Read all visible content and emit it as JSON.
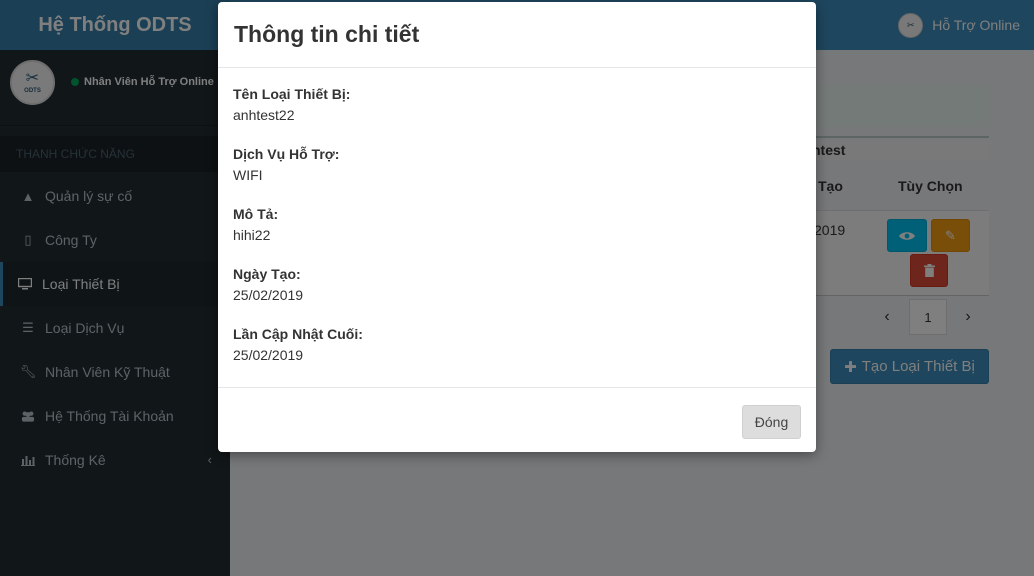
{
  "app": {
    "logo": "Hệ Thống ODTS",
    "header_user": "Hỗ Trợ Online",
    "avatar_text": "ODTS"
  },
  "sidebar": {
    "user_status": "Nhân Viên Hỗ Trợ Online",
    "section_header": "THANH CHỨC NĂNG",
    "items": [
      {
        "label": "Quản lý sự cố",
        "icon": "warning-icon"
      },
      {
        "label": "Công Ty",
        "icon": "building-icon"
      },
      {
        "label": "Loại Thiết Bị",
        "icon": "desktop-icon",
        "active": true
      },
      {
        "label": "Loại Dịch Vụ",
        "icon": "list-icon"
      },
      {
        "label": "Nhân Viên Kỹ Thuật",
        "icon": "wrench-icon"
      },
      {
        "label": "Hệ Thống Tài Khoản",
        "icon": "users-icon"
      },
      {
        "label": "Thống Kê",
        "icon": "bar-chart-icon",
        "has_submenu": true
      }
    ]
  },
  "background_content": {
    "strip_text": "ntest",
    "col_created": "Tạo",
    "col_options": "Tùy Chọn",
    "row_date": "2019",
    "current_page": "1",
    "create_button": "Tạo Loại Thiết Bị"
  },
  "modal": {
    "title": "Thông tin chi tiết",
    "fields": [
      {
        "label": "Tên Loại Thiết Bị:",
        "value": "anhtest22"
      },
      {
        "label": "Dịch Vụ Hỗ Trợ:",
        "value": "WIFI"
      },
      {
        "label": "Mô Tả:",
        "value": "hihi22"
      },
      {
        "label": "Ngày Tạo:",
        "value": "25/02/2019"
      },
      {
        "label": "Lần Cập Nhật Cuối:",
        "value": "25/02/2019"
      }
    ],
    "close_label": "Đóng"
  },
  "colors": {
    "header": "#3c8dbc",
    "sidebar": "#222d32",
    "info": "#00c0ef",
    "warning": "#f39c12",
    "danger": "#dd4b39"
  }
}
